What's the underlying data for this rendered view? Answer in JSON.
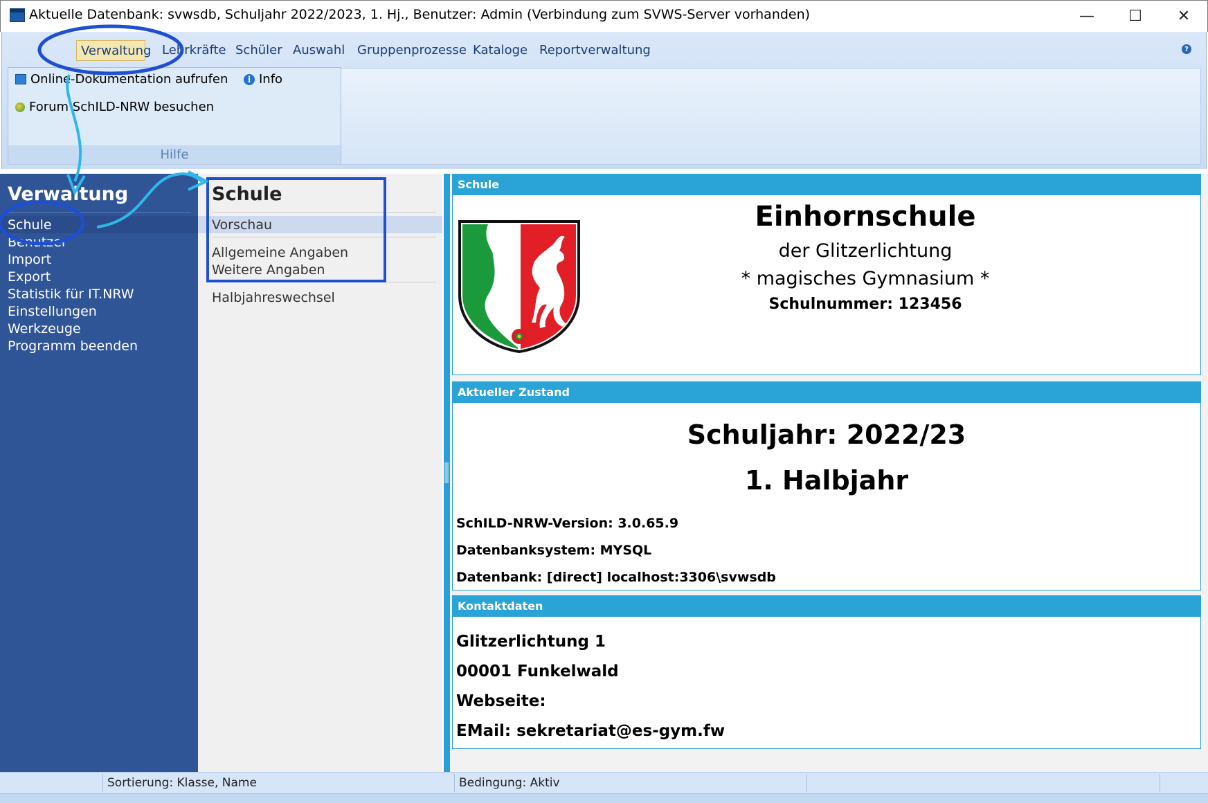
{
  "window": {
    "title": "Aktuelle Datenbank: svwsdb, Schuljahr 2022/2023, 1. Hj., Benutzer: Admin (Verbindung zum SVWS-Server vorhanden)",
    "minimize": "—",
    "maximize": "☐",
    "close": "✕"
  },
  "ribbon": {
    "tabs": [
      "Verwaltung",
      "Lehrkräfte",
      "Schüler",
      "Auswahl",
      "Gruppenprozesse",
      "Kataloge",
      "Reportverwaltung"
    ],
    "active_tab": "Verwaltung",
    "help_icon": "?",
    "group": {
      "label": "Hilfe",
      "items": [
        {
          "label": "Online-Dokumentation aufrufen",
          "icon": "monitor-icon"
        },
        {
          "label": "Info",
          "icon": "info-icon"
        },
        {
          "label": "Forum SchILD-NRW besuchen",
          "icon": "globe-icon"
        }
      ]
    }
  },
  "nav": {
    "heading": "Verwaltung",
    "items": [
      "Schule",
      "Benutzer",
      "Import",
      "Export",
      "Statistik für IT.NRW",
      "Einstellungen",
      "Werkzeuge",
      "Programm beenden"
    ],
    "selected": "Schule"
  },
  "submenu": {
    "heading": "Schule",
    "items": [
      "Vorschau",
      "Allgemeine Angaben",
      "Weitere Angaben",
      "Halbjahreswechsel"
    ],
    "selected": "Vorschau"
  },
  "school_panel": {
    "header": "Schule",
    "name": "Einhornschule",
    "line2": "der Glitzerlichtung",
    "line3": "* magisches Gymnasium *",
    "number": "Schulnummer: 123456"
  },
  "state_panel": {
    "header": "Aktueller Zustand",
    "schoolyear": "Schuljahr: 2022/23",
    "term": "1. Halbjahr",
    "version": "SchILD-NRW-Version: 3.0.65.9",
    "dbsystem": "Datenbanksystem: MYSQL",
    "database": "Datenbank: [direct] localhost:3306\\svwsdb"
  },
  "contact_panel": {
    "header": "Kontaktdaten",
    "street": "Glitzerlichtung 1",
    "city": "00001 Funkelwald",
    "website": "Webseite:",
    "email": "EMail: sekretariat@es-gym.fw"
  },
  "statusbar": {
    "sort": "Sortierung: Klasse, Name",
    "condition": "Bedingung: Aktiv"
  },
  "colors": {
    "nav_bg": "#2f5597",
    "panel_header": "#2aa3d6",
    "annotation": "#1f4fd1",
    "arrow": "#2fb7ea"
  }
}
